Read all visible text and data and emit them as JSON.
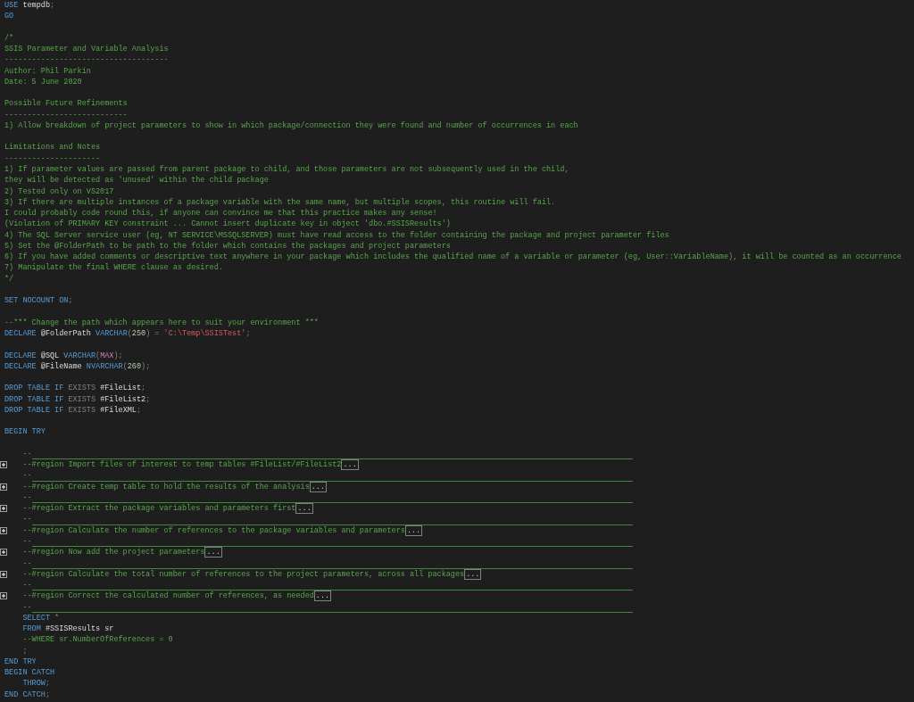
{
  "editor": {
    "lines": [
      {
        "kind": "code",
        "tokens": [
          {
            "text": "USE ",
            "kind": "keyword"
          },
          {
            "text": "tempdb",
            "kind": "identifier"
          },
          {
            "text": ";",
            "kind": "operator"
          }
        ]
      },
      {
        "kind": "code",
        "tokens": [
          {
            "text": "GO",
            "kind": "keyword"
          }
        ]
      },
      {
        "kind": "blank"
      },
      {
        "kind": "code",
        "tokens": [
          {
            "text": "/*",
            "kind": "comment"
          }
        ]
      },
      {
        "kind": "code",
        "tokens": [
          {
            "text": "SSIS Parameter and Variable Analysis",
            "kind": "comment"
          }
        ]
      },
      {
        "kind": "code",
        "tokens": [
          {
            "text": "------------------------------------",
            "kind": "comment"
          }
        ]
      },
      {
        "kind": "code",
        "tokens": [
          {
            "text": "Author: Phil Parkin",
            "kind": "comment"
          }
        ]
      },
      {
        "kind": "code",
        "tokens": [
          {
            "text": "Date: 5 June 2020",
            "kind": "comment"
          }
        ]
      },
      {
        "kind": "blank"
      },
      {
        "kind": "code",
        "tokens": [
          {
            "text": "Possible Future Refinements",
            "kind": "comment"
          }
        ]
      },
      {
        "kind": "code",
        "tokens": [
          {
            "text": "---------------------------",
            "kind": "comment"
          }
        ]
      },
      {
        "kind": "code",
        "tokens": [
          {
            "text": "1) Allow breakdown of project parameters to show in which package/connection they were found and number of occurrences in each",
            "kind": "comment"
          }
        ]
      },
      {
        "kind": "blank"
      },
      {
        "kind": "code",
        "tokens": [
          {
            "text": "Limitations and Notes",
            "kind": "comment"
          }
        ]
      },
      {
        "kind": "code",
        "tokens": [
          {
            "text": "---------------------",
            "kind": "comment"
          }
        ]
      },
      {
        "kind": "code",
        "tokens": [
          {
            "text": "1) If parameter values are passed from parent package to child, and those parameters are not subsequently used in the child,",
            "kind": "comment"
          }
        ]
      },
      {
        "kind": "code",
        "tokens": [
          {
            "text": "they will be detected as 'unused' within the child package",
            "kind": "comment"
          }
        ]
      },
      {
        "kind": "code",
        "tokens": [
          {
            "text": "2) Tested only on VS2017",
            "kind": "comment"
          }
        ]
      },
      {
        "kind": "code",
        "tokens": [
          {
            "text": "3) If there are multiple instances of a package variable with the same name, but multiple scopes, this routine will fail.",
            "kind": "comment"
          }
        ]
      },
      {
        "kind": "code",
        "tokens": [
          {
            "text": "I could probably code round this, if anyone can convince me that this practice makes any sense!",
            "kind": "comment"
          }
        ]
      },
      {
        "kind": "code",
        "tokens": [
          {
            "text": "(Violation of PRIMARY KEY constraint ... Cannot insert duplicate key in object 'dbo.#SSISResults')",
            "kind": "comment"
          }
        ]
      },
      {
        "kind": "code",
        "tokens": [
          {
            "text": "4) The SQL Server service user (eg, NT SERVICE\\MSSQLSERVER) must have read access to the folder containing the package and project parameter files",
            "kind": "comment"
          }
        ]
      },
      {
        "kind": "code",
        "tokens": [
          {
            "text": "5) Set the @FolderPath to be path to the folder which contains the packages and project parameters",
            "kind": "comment"
          }
        ]
      },
      {
        "kind": "code",
        "tokens": [
          {
            "text": "6) If you have added comments or descriptive text anywhere in your package which includes the qualified name of a variable or parameter (eg, User::VariableName), it will be counted as an occurrence",
            "kind": "comment"
          }
        ]
      },
      {
        "kind": "code",
        "tokens": [
          {
            "text": "7) Manipulate the final WHERE clause as desired.",
            "kind": "comment"
          }
        ]
      },
      {
        "kind": "code",
        "tokens": [
          {
            "text": "*/",
            "kind": "comment"
          }
        ]
      },
      {
        "kind": "blank"
      },
      {
        "kind": "code",
        "tokens": [
          {
            "text": "SET NOCOUNT ON",
            "kind": "keyword"
          },
          {
            "text": ";",
            "kind": "operator"
          }
        ]
      },
      {
        "kind": "blank"
      },
      {
        "kind": "code",
        "tokens": [
          {
            "text": "--*** Change the path which appears here to suit your environment ***",
            "kind": "comment"
          }
        ]
      },
      {
        "kind": "code",
        "tokens": [
          {
            "text": "DECLARE ",
            "kind": "keyword"
          },
          {
            "text": "@FolderPath ",
            "kind": "identifier"
          },
          {
            "text": "VARCHAR",
            "kind": "keyword"
          },
          {
            "text": "(",
            "kind": "operator"
          },
          {
            "text": "250",
            "kind": "number"
          },
          {
            "text": ") = ",
            "kind": "operator"
          },
          {
            "text": "'C:\\Temp\\SSISTest'",
            "kind": "string"
          },
          {
            "text": ";",
            "kind": "operator"
          }
        ]
      },
      {
        "kind": "blank"
      },
      {
        "kind": "code",
        "tokens": [
          {
            "text": "DECLARE ",
            "kind": "keyword"
          },
          {
            "text": "@SQL ",
            "kind": "identifier"
          },
          {
            "text": "VARCHAR",
            "kind": "keyword"
          },
          {
            "text": "(",
            "kind": "operator"
          },
          {
            "text": "MAX",
            "kind": "function"
          },
          {
            "text": ");",
            "kind": "operator"
          }
        ]
      },
      {
        "kind": "code",
        "tokens": [
          {
            "text": "DECLARE ",
            "kind": "keyword"
          },
          {
            "text": "@FileName ",
            "kind": "identifier"
          },
          {
            "text": "NVARCHAR",
            "kind": "keyword"
          },
          {
            "text": "(",
            "kind": "operator"
          },
          {
            "text": "260",
            "kind": "number"
          },
          {
            "text": ");",
            "kind": "operator"
          }
        ]
      },
      {
        "kind": "blank"
      },
      {
        "kind": "code",
        "tokens": [
          {
            "text": "DROP TABLE IF ",
            "kind": "keyword"
          },
          {
            "text": "EXISTS ",
            "kind": "operator"
          },
          {
            "text": "#FileList",
            "kind": "identifier"
          },
          {
            "text": ";",
            "kind": "operator"
          }
        ]
      },
      {
        "kind": "code",
        "tokens": [
          {
            "text": "DROP TABLE IF ",
            "kind": "keyword"
          },
          {
            "text": "EXISTS ",
            "kind": "operator"
          },
          {
            "text": "#FileList2",
            "kind": "identifier"
          },
          {
            "text": ";",
            "kind": "operator"
          }
        ]
      },
      {
        "kind": "code",
        "tokens": [
          {
            "text": "DROP TABLE IF ",
            "kind": "keyword"
          },
          {
            "text": "EXISTS ",
            "kind": "operator"
          },
          {
            "text": "#FileXML",
            "kind": "identifier"
          },
          {
            "text": ";",
            "kind": "operator"
          }
        ]
      },
      {
        "kind": "blank"
      },
      {
        "kind": "code",
        "tokens": [
          {
            "text": "BEGIN TRY",
            "kind": "keyword"
          }
        ],
        "children": [
          {
            "kind": "blank"
          },
          {
            "kind": "separator",
            "text": "--"
          },
          {
            "kind": "region",
            "text": "--#region Import files of interest to temp tables #FileList/#FileList2",
            "ellipsis": "...",
            "collapsed": true
          },
          {
            "kind": "separator",
            "text": "--"
          },
          {
            "kind": "region",
            "text": "--#region Create temp table to hold the results of the analysis",
            "ellipsis": "...",
            "collapsed": true
          },
          {
            "kind": "separator",
            "text": "--"
          },
          {
            "kind": "region",
            "text": "--#region Extract the package variables and parameters first",
            "ellipsis": "...",
            "collapsed": true
          },
          {
            "kind": "separator",
            "text": "--"
          },
          {
            "kind": "region",
            "text": "--#region Calculate the number of references to the package variables and parameters",
            "ellipsis": "...",
            "collapsed": true
          },
          {
            "kind": "separator",
            "text": "--"
          },
          {
            "kind": "region",
            "text": "--#region Now add the project parameters",
            "ellipsis": "...",
            "collapsed": true
          },
          {
            "kind": "separator",
            "text": "--"
          },
          {
            "kind": "region",
            "text": "--#region Calculate the total number of references to the project parameters, across all packages",
            "ellipsis": "...",
            "collapsed": true
          },
          {
            "kind": "separator",
            "text": "--"
          },
          {
            "kind": "region",
            "text": "--#region Correct the calculated number of references, as needed",
            "ellipsis": "...",
            "collapsed": true
          },
          {
            "kind": "separator",
            "text": "--"
          },
          {
            "kind": "code",
            "tokens": [
              {
                "text": "SELECT ",
                "kind": "keyword"
              },
              {
                "text": "*",
                "kind": "operator"
              }
            ]
          },
          {
            "kind": "code",
            "tokens": [
              {
                "text": "FROM ",
                "kind": "keyword"
              },
              {
                "text": "#SSISResults sr",
                "kind": "identifier"
              }
            ]
          },
          {
            "kind": "code",
            "tokens": [
              {
                "text": "--WHERE sr.NumberOfReferences = 0",
                "kind": "comment"
              }
            ]
          },
          {
            "kind": "code",
            "tokens": [
              {
                "text": ";",
                "kind": "operator"
              }
            ]
          }
        ]
      },
      {
        "kind": "code",
        "tokens": [
          {
            "text": "END TRY",
            "kind": "keyword"
          }
        ]
      },
      {
        "kind": "code",
        "tokens": [
          {
            "text": "BEGIN CATCH",
            "kind": "keyword"
          }
        ],
        "children": [
          {
            "kind": "code",
            "tokens": [
              {
                "text": "THROW",
                "kind": "keyword"
              },
              {
                "text": ";",
                "kind": "operator"
              }
            ]
          }
        ]
      },
      {
        "kind": "code",
        "tokens": [
          {
            "text": "END CATCH",
            "kind": "keyword"
          },
          {
            "text": ";",
            "kind": "operator"
          }
        ]
      }
    ]
  }
}
